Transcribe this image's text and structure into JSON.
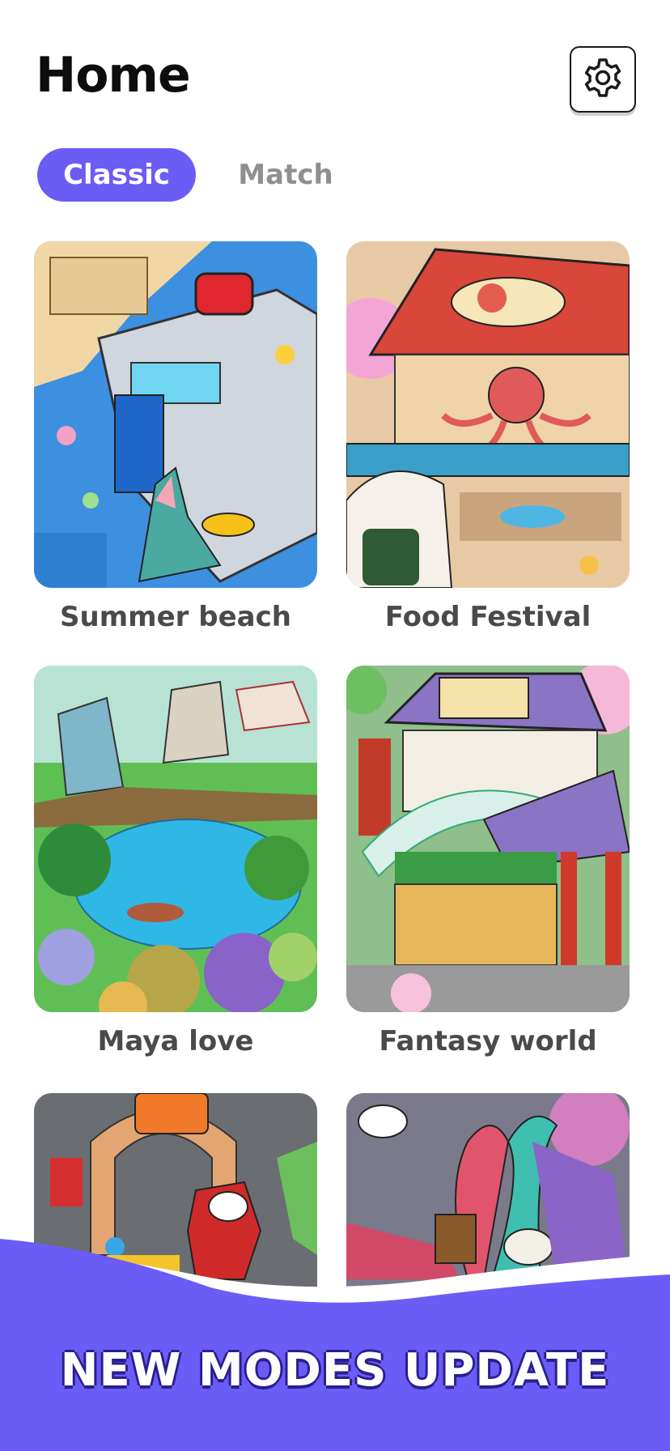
{
  "header": {
    "title": "Home",
    "settings_icon": "gear-icon"
  },
  "tabs": [
    {
      "label": "Classic",
      "active": true
    },
    {
      "label": "Match",
      "active": false
    }
  ],
  "levels": [
    {
      "name": "Summer beach"
    },
    {
      "name": "Food Festival"
    },
    {
      "name": "Maya love"
    },
    {
      "name": "Fantasy world"
    },
    {
      "name": ""
    },
    {
      "name": ""
    }
  ],
  "banner": {
    "text": "NEW MODES UPDATE"
  },
  "colors": {
    "accent": "#6b5cf6",
    "tab_inactive": "#8f8f8f",
    "label": "#4a4a4a"
  }
}
